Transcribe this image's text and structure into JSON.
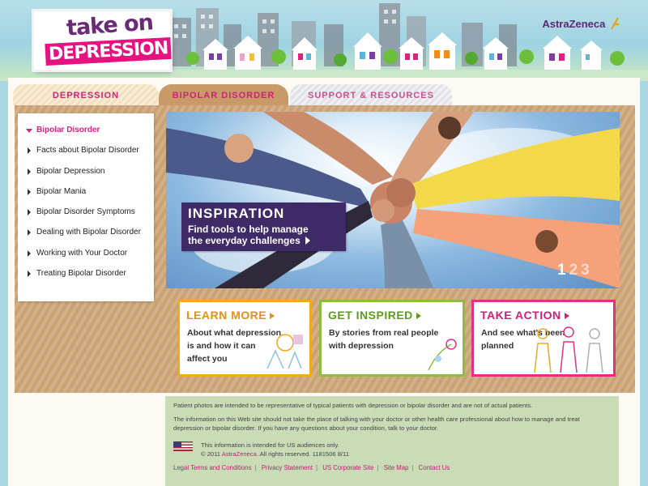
{
  "header": {
    "logo_line1": "take on",
    "logo_line2": "DEPRESSION",
    "brand": "AstraZeneca"
  },
  "tabs": [
    {
      "label": "DEPRESSION",
      "active": false
    },
    {
      "label": "BIPOLAR DISORDER",
      "active": true
    },
    {
      "label": "SUPPORT & RESOURCES",
      "active": false
    }
  ],
  "sidebar": {
    "items": [
      {
        "label": "Bipolar Disorder",
        "active": true
      },
      {
        "label": "Facts about Bipolar Disorder",
        "active": false
      },
      {
        "label": "Bipolar Depression",
        "active": false
      },
      {
        "label": "Bipolar Mania",
        "active": false
      },
      {
        "label": "Bipolar Disorder Symptoms",
        "active": false
      },
      {
        "label": "Dealing with Bipolar Disorder",
        "active": false
      },
      {
        "label": "Working with Your Doctor",
        "active": false
      },
      {
        "label": "Treating Bipolar Disorder",
        "active": false
      }
    ]
  },
  "hero": {
    "title": "INSPIRATION",
    "line1": "Find tools to help manage",
    "line2": "the everyday challenges",
    "pager": [
      "1",
      "2",
      "3"
    ],
    "current_page": 1
  },
  "promos": {
    "learn": {
      "title": "LEARN MORE",
      "line1": "About what depression",
      "line2": "is and how it can",
      "line3": "affect you"
    },
    "inspired": {
      "title": "GET INSPIRED",
      "line1": "By stories from real people",
      "line2": "with depression"
    },
    "action": {
      "title": "TAKE ACTION",
      "line1": "And see what's been",
      "line2": "planned"
    }
  },
  "footer": {
    "disclaimer1": "Patient photos are intended to be representative of typical patients with depression or bipolar disorder and are not of actual patients.",
    "disclaimer2": "The information on this Web site should not take the place of talking with your doctor or other health care professional about how to manage and treat depression or bipolar disorder. If you have any questions about your condition, talk to your doctor.",
    "us_notice": "This information is intended for US audiences only.",
    "copyright_pre": "© 2011",
    "copyright_company": "AstraZeneca",
    "copyright_post": ". All rights reserved. 1181506 8/11",
    "links": [
      "Legal Terms and Conditions",
      "Privacy Statement",
      "US Corporate Site",
      "Site Map",
      "Contact Us"
    ]
  },
  "colors": {
    "accent_pink": "#e0217f",
    "purple": "#3d2a66",
    "orange": "#f4a91c",
    "green": "#8cbd3e"
  }
}
